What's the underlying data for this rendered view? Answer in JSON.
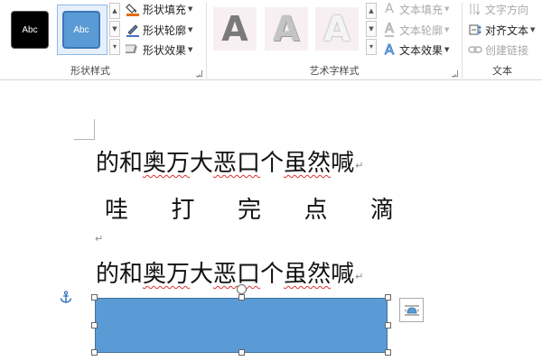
{
  "ribbon": {
    "shape_styles": {
      "label": "形状样式",
      "thumb_dark_text": "Abc",
      "thumb_blue_text": "Abc",
      "fill": "形状填充",
      "outline": "形状轮廓",
      "effects": "形状效果"
    },
    "wordart_styles": {
      "label": "艺术字样式",
      "samples": [
        "A",
        "A",
        "A"
      ],
      "text_fill": "文本填充",
      "text_outline": "文本轮廓",
      "text_effects": "文本效果"
    },
    "text": {
      "label": "文本",
      "direction": "文字方向",
      "align": "对齐文本",
      "create_link": "创建链接"
    }
  },
  "document": {
    "line1": {
      "plain_a": "的和",
      "squiggle_a": "奥万",
      "plain_b": "大",
      "squiggle_b": "恶口",
      "plain_c": "个",
      "squiggle_c": "虽然",
      "plain_d": "喊"
    },
    "line2": [
      "哇",
      "打",
      "完",
      "点",
      "滴"
    ],
    "line3": {
      "plain_a": "的和",
      "squiggle_a": "奥万",
      "plain_b": "大",
      "squiggle_b": "恶口",
      "plain_c": "个",
      "squiggle_c": "虽然",
      "plain_d": "喊"
    },
    "paragraph_mark": "↵"
  },
  "colors": {
    "shape_fill": "#5b9bd5",
    "shape_border": "#41719c",
    "accent": "#e36c09"
  }
}
